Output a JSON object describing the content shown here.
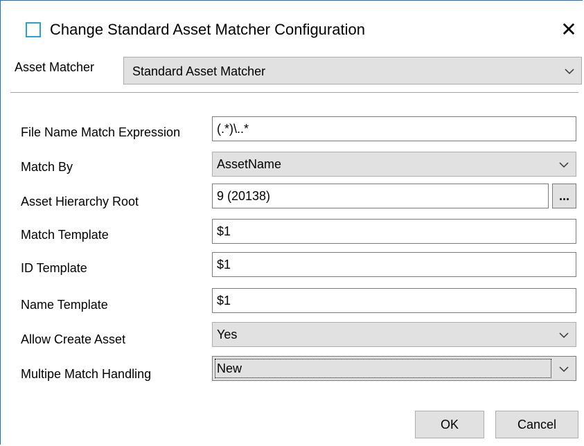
{
  "window": {
    "title": "Change Standard Asset Matcher Configuration",
    "close_symbol": "✕"
  },
  "asset_matcher": {
    "label": "Asset Matcher",
    "value": "Standard Asset Matcher"
  },
  "fields": {
    "file_name_match_expression": {
      "label": "File Name Match Expression",
      "value": "(.*)\\..*"
    },
    "match_by": {
      "label": "Match By",
      "value": "AssetName"
    },
    "asset_hierarchy_root": {
      "label": "Asset Hierarchy Root",
      "value": "9 (20138)",
      "browse_label": "..."
    },
    "match_template": {
      "label": "Match Template",
      "value": "$1"
    },
    "id_template": {
      "label": "ID Template",
      "value": "$1"
    },
    "name_template": {
      "label": "Name Template",
      "value": "$1"
    },
    "allow_create_asset": {
      "label": "Allow Create Asset",
      "value": "Yes"
    },
    "multiple_match_handling": {
      "label": "Multipe Match Handling",
      "value": "New"
    }
  },
  "buttons": {
    "ok_label": "OK",
    "cancel_label": "Cancel"
  },
  "icons": {
    "app": "window-icon",
    "close": "close-icon",
    "dropdown": "chevron-down-icon"
  },
  "colors": {
    "window_border": "#1a73c8",
    "app_icon": "#2aa0d8",
    "control_face": "#e1e1e1"
  }
}
